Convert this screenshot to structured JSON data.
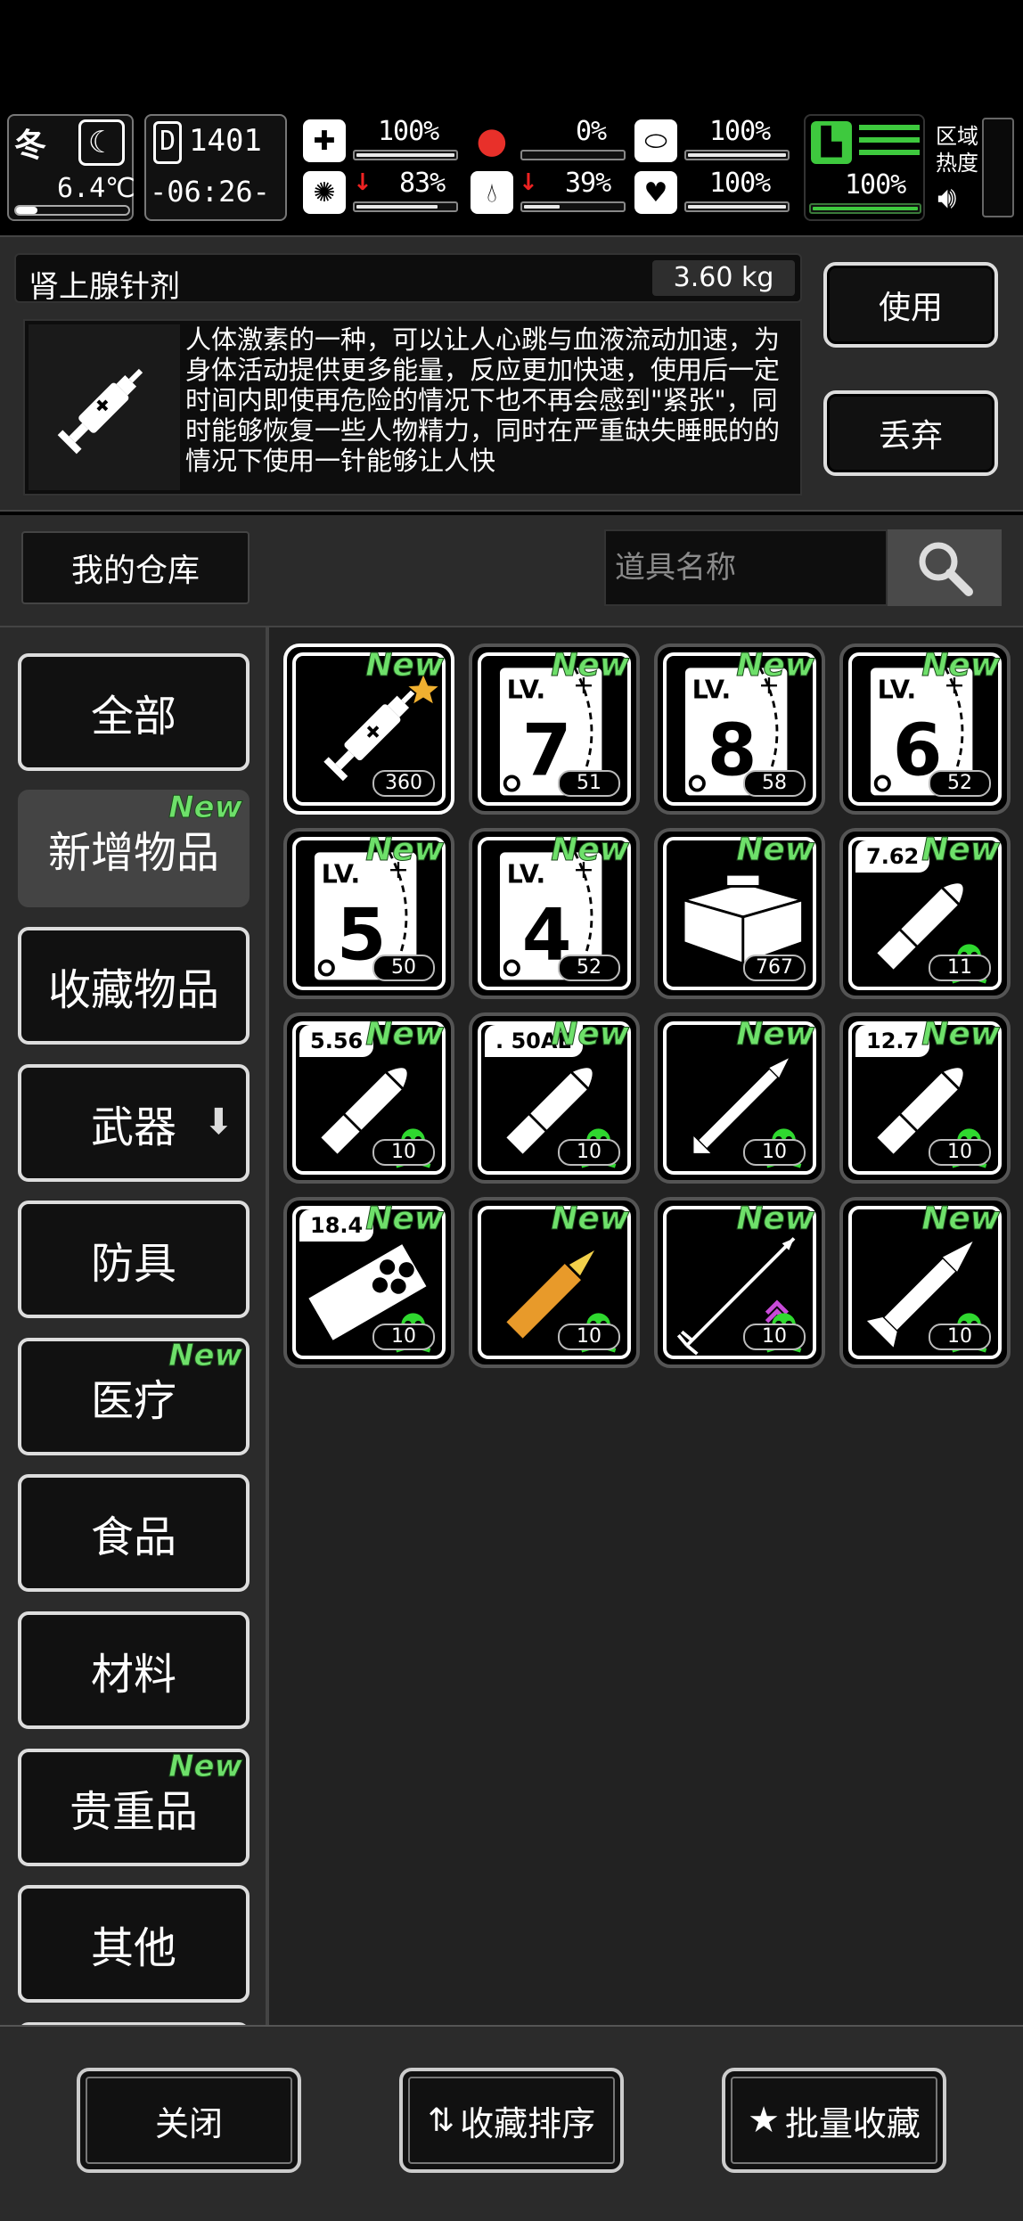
{
  "hud": {
    "season": "冬",
    "temperature": "6.4℃",
    "day": "1401",
    "time": "-06:26-",
    "stats": [
      {
        "name": "health",
        "value": "100%",
        "level": 1.0
      },
      {
        "name": "hunger",
        "value": "0%",
        "level": 0.0
      },
      {
        "name": "bowel",
        "value": "100%",
        "level": 1.0
      },
      {
        "name": "stamina",
        "value": "100%",
        "level": 1.0
      },
      {
        "name": "sanity",
        "value": "83%",
        "level": 0.83,
        "falling": true
      },
      {
        "name": "thirst",
        "value": "39%",
        "level": 0.39,
        "falling": true
      },
      {
        "name": "mood",
        "value": "100%",
        "level": 1.0
      }
    ],
    "zone_heat_label": "区域\n热度"
  },
  "detail": {
    "item_name": "肾上腺针剂",
    "weight": "3.60 kg",
    "description": "人体激素的一种，可以让人心跳与血液流动加速，为身体活动提供更多能量，反应更加快速，使用后一定时间内即使再危险的情况下也不再会感到\"紧张\"，同时能够恢复一些人物精力，同时在严重缺失睡眠的的情况下使用一针能够让人快",
    "use_label": "使用",
    "discard_label": "丢弃"
  },
  "search": {
    "warehouse_label": "我的仓库",
    "placeholder": "道具名称"
  },
  "categories": [
    {
      "label": "全部",
      "new": false
    },
    {
      "label": "新增物品",
      "new": true,
      "active": true
    },
    {
      "label": "收藏物品",
      "new": false
    },
    {
      "label": "武器",
      "new": false,
      "has_arrow": true
    },
    {
      "label": "防具",
      "new": false
    },
    {
      "label": "医疗",
      "new": true
    },
    {
      "label": "食品",
      "new": false
    },
    {
      "label": "材料",
      "new": false
    },
    {
      "label": "贵重品",
      "new": true
    },
    {
      "label": "其他",
      "new": false
    }
  ],
  "new_label": "New",
  "items": [
    {
      "art": "syringe",
      "count": "360",
      "starred": true
    },
    {
      "art": "book",
      "level": "7",
      "count": "51"
    },
    {
      "art": "book",
      "level": "8",
      "count": "58"
    },
    {
      "art": "book",
      "level": "6",
      "count": "52"
    },
    {
      "art": "book",
      "level": "5",
      "count": "50"
    },
    {
      "art": "book",
      "level": "4",
      "count": "52"
    },
    {
      "art": "toolbox",
      "count": "767"
    },
    {
      "art": "bullet",
      "caliber": "7.62",
      "count": "11",
      "toxic": true
    },
    {
      "art": "bullet",
      "caliber": "5.56",
      "count": "10",
      "toxic": true
    },
    {
      "art": "bullet",
      "caliber": ". 50AE",
      "count": "10",
      "toxic": true
    },
    {
      "art": "dart",
      "count": "10",
      "toxic": true
    },
    {
      "art": "bullet",
      "caliber": "12.7",
      "count": "10",
      "toxic": true
    },
    {
      "art": "shell",
      "caliber": "18.4",
      "count": "10",
      "toxic": true
    },
    {
      "art": "orange-round",
      "count": "10",
      "toxic": true
    },
    {
      "art": "arrow",
      "count": "10",
      "toxic": true,
      "upgraded": true
    },
    {
      "art": "rocket",
      "count": "10",
      "toxic": true
    }
  ],
  "bottom": {
    "close_label": "关闭",
    "sort_label": "收藏排序",
    "batch_label": "批量收藏"
  },
  "colors": {
    "new_green": "#6ee06a",
    "panel_gray": "#2b2b2b",
    "toxic_green": "#2fd82f",
    "stat_green": "#3ec93e",
    "hunger_red": "#e8302a"
  }
}
